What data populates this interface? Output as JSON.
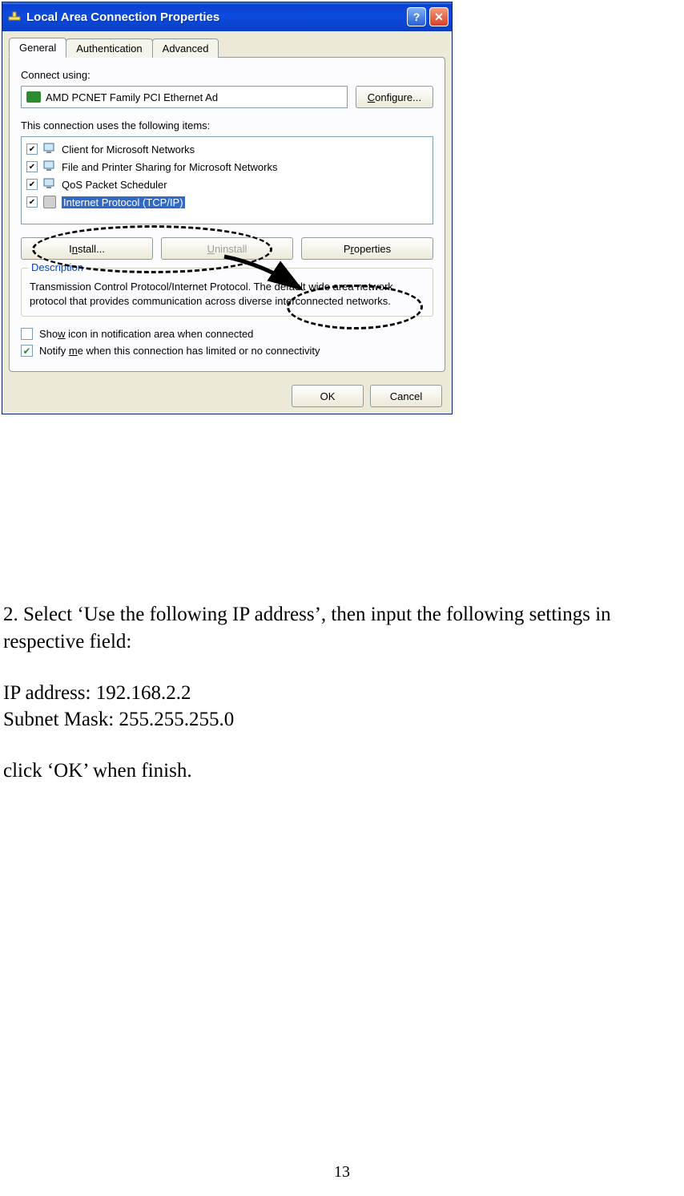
{
  "dialog": {
    "title": "Local Area Connection Properties",
    "tabs": [
      "General",
      "Authentication",
      "Advanced"
    ],
    "connect_using_label": "Connect using:",
    "adapter_name": "AMD PCNET Family PCI Ethernet Ad",
    "configure_btn": "Configure...",
    "items_label": "This connection uses the following items:",
    "items": [
      {
        "label": "Client for Microsoft Networks",
        "checked": true,
        "selected": false,
        "icon": "monitor"
      },
      {
        "label": "File and Printer Sharing for Microsoft Networks",
        "checked": true,
        "selected": false,
        "icon": "monitor"
      },
      {
        "label": "QoS Packet Scheduler",
        "checked": true,
        "selected": false,
        "icon": "monitor"
      },
      {
        "label": "Internet Protocol (TCP/IP)",
        "checked": true,
        "selected": true,
        "icon": "proto"
      }
    ],
    "install_btn": "Install...",
    "uninstall_btn": "Uninstall",
    "properties_btn": "Properties",
    "description_legend": "Description",
    "description_text": "Transmission Control Protocol/Internet Protocol. The default wide area network protocol that provides communication across diverse interconnected networks.",
    "show_icon_label": "Show icon in notification area when connected",
    "notify_label": "Notify me when this connection has limited or no connectivity",
    "show_icon_checked": false,
    "notify_checked": true,
    "ok_btn": "OK",
    "cancel_btn": "Cancel"
  },
  "prose": {
    "step": "2. Select ‘Use the following IP address’, then input the following settings in respective field:",
    "ip_line": "IP address: 192.168.2.2",
    "mask_line": "Subnet Mask: 255.255.255.0",
    "finish": "click ‘OK’ when finish."
  },
  "page_number": "13"
}
